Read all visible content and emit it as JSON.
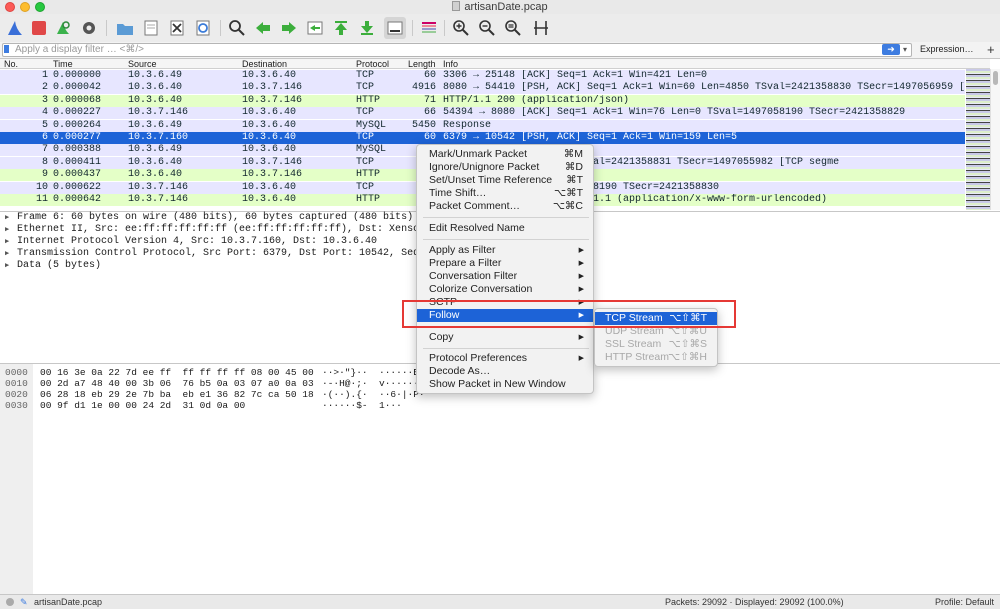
{
  "window": {
    "title": "artisanDate.pcap"
  },
  "filter": {
    "placeholder": "Apply a display filter … <⌘/>",
    "expression_label": "Expression…",
    "add_label": "+"
  },
  "columns": {
    "no": "No.",
    "time": "Time",
    "source": "Source",
    "destination": "Destination",
    "protocol": "Protocol",
    "length": "Length",
    "info": "Info"
  },
  "packets": [
    {
      "no": "1",
      "time": "0.000000",
      "src": "10.3.6.49",
      "dst": "10.3.6.40",
      "proto": "TCP",
      "len": "60",
      "info": "3306 → 25148 [ACK] Seq=1 Ack=1 Win=421 Len=0",
      "bg": "#e7e6ff",
      "fg": "#12272e"
    },
    {
      "no": "2",
      "time": "0.000042",
      "src": "10.3.6.40",
      "dst": "10.3.7.146",
      "proto": "TCP",
      "len": "4916",
      "info": "8080 → 54410 [PSH, ACK] Seq=1 Ack=1 Win=60 Len=4850 TSval=2421358830 TSecr=1497056959 [TCP segme",
      "bg": "#e7e6ff",
      "fg": "#12272e"
    },
    {
      "no": "3",
      "time": "0.000068",
      "src": "10.3.6.40",
      "dst": "10.3.7.146",
      "proto": "HTTP",
      "len": "71",
      "info": "HTTP/1.1 200   (application/json)",
      "bg": "#e4ffc7",
      "fg": "#12272e"
    },
    {
      "no": "4",
      "time": "0.000227",
      "src": "10.3.7.146",
      "dst": "10.3.6.40",
      "proto": "TCP",
      "len": "66",
      "info": "54394 → 8080 [ACK] Seq=1 Ack=1 Win=76 Len=0 TSval=1497058190 TSecr=2421358829",
      "bg": "#e7e6ff",
      "fg": "#12272e"
    },
    {
      "no": "5",
      "time": "0.000264",
      "src": "10.3.6.49",
      "dst": "10.3.6.40",
      "proto": "MySQL",
      "len": "5450",
      "info": "Response",
      "bg": "#e7e6ff",
      "fg": "#12272e"
    },
    {
      "no": "6",
      "time": "0.000277",
      "src": "10.3.7.160",
      "dst": "10.3.6.40",
      "proto": "TCP",
      "len": "60",
      "info": "6379 → 10542 [PSH, ACK] Seq=1 Ack=1 Win=159 Len=5",
      "bg": "#1d63d7",
      "fg": "#ffffff"
    },
    {
      "no": "7",
      "time": "0.000388",
      "src": "10.3.6.49",
      "dst": "10.3.6.40",
      "proto": "MySQL",
      "len": "",
      "info": "",
      "bg": "#e7e6ff",
      "fg": "#12272e"
    },
    {
      "no": "8",
      "time": "0.000411",
      "src": "10.3.6.40",
      "dst": "10.3.7.146",
      "proto": "TCP",
      "len": "",
      "info": "           Ack=1 Win=60 Len=4849 TSval=2421358831 TSecr=1497055982 [TCP segme",
      "bg": "#e7e6ff",
      "fg": "#12272e"
    },
    {
      "no": "9",
      "time": "0.000437",
      "src": "10.3.6.40",
      "dst": "10.3.7.146",
      "proto": "HTTP",
      "len": "",
      "info": "                                  /json)",
      "bg": "#e4ffc7",
      "fg": "#12272e"
    },
    {
      "no": "10",
      "time": "0.000622",
      "src": "10.3.7.146",
      "dst": "10.3.6.40",
      "proto": "TCP",
      "len": "",
      "info": "           Win=58 Len=0 TSval=1497058190 TSecr=2421358830",
      "bg": "#e7e6ff",
      "fg": "#12272e"
    },
    {
      "no": "11",
      "time": "0.000642",
      "src": "10.3.7.146",
      "dst": "10.3.6.40",
      "proto": "HTTP",
      "len": "",
      "info": "                                  t/stock/artisanDate HTTP/1.1  (application/x-www-form-urlencoded)",
      "bg": "#e4ffc7",
      "fg": "#12272e"
    }
  ],
  "details": [
    "Frame 6: 60 bytes on wire (480 bits), 60 bytes captured (480 bits)",
    "Ethernet II, Src: ee:ff:ff:ff:ff:ff (ee:ff:ff:ff:ff:ff), Dst: Xensourc_0a",
    "Internet Protocol Version 4, Src: 10.3.7.160, Dst: 10.3.6.40",
    "Transmission Control Protocol, Src Port: 6379, Dst Port: 10542, Seq: 1, Ac",
    "Data (5 bytes)"
  ],
  "bytes": [
    {
      "off": "0000",
      "hex": "00 16 3e 0a 22 7d ee ff  ff ff ff ff 08 00 45 00",
      "ascii": "··>·\"}··  ······E"
    },
    {
      "off": "0010",
      "hex": "00 2d a7 48 40 00 3b 06  76 b5 0a 03 07 a0 0a 03",
      "ascii": "·-·H@·;·  v·······"
    },
    {
      "off": "0020",
      "hex": "06 28 18 eb 29 2e 7b ba  eb e1 36 82 7c ca 50 18",
      "ascii": "·(··).{·  ··6·|·P·"
    },
    {
      "off": "0030",
      "hex": "00 9f d1 1e 00 00 24 2d  31 0d 0a 00",
      "ascii": "······$-  1···"
    }
  ],
  "context_menu": {
    "mark": {
      "label": "Mark/Unmark Packet",
      "shortcut": "⌘M"
    },
    "ignore": {
      "label": "Ignore/Unignore Packet",
      "shortcut": "⌘D"
    },
    "timeref": {
      "label": "Set/Unset Time Reference",
      "shortcut": "⌘T"
    },
    "timeshift": {
      "label": "Time Shift…",
      "shortcut": "⌥⌘T"
    },
    "comment": {
      "label": "Packet Comment…",
      "shortcut": "⌥⌘C"
    },
    "edit_resolved": {
      "label": "Edit Resolved Name"
    },
    "apply_filter": {
      "label": "Apply as Filter"
    },
    "prepare_filter": {
      "label": "Prepare a Filter"
    },
    "conv_filter": {
      "label": "Conversation Filter"
    },
    "colorize": {
      "label": "Colorize Conversation"
    },
    "sctp": {
      "label": "SCTP"
    },
    "follow": {
      "label": "Follow"
    },
    "copy": {
      "label": "Copy"
    },
    "proto_prefs": {
      "label": "Protocol Preferences"
    },
    "decode_as": {
      "label": "Decode As…"
    },
    "show_packet": {
      "label": "Show Packet in New Window"
    }
  },
  "follow_submenu": {
    "tcp": {
      "label": "TCP Stream",
      "shortcut": "⌥⇧⌘T"
    },
    "udp": {
      "label": "UDP Stream",
      "shortcut": "⌥⇧⌘U"
    },
    "ssl": {
      "label": "SSL Stream",
      "shortcut": "⌥⇧⌘S"
    },
    "http": {
      "label": "HTTP Stream",
      "shortcut": "⌥⇧⌘H"
    }
  },
  "status": {
    "file": "artisanDate.pcap",
    "packets": "Packets: 29092 · Displayed: 29092 (100.0%)",
    "profile": "Profile: Default"
  },
  "colors": {
    "selection": "#1d63d7",
    "tcp_row": "#e7e6ff",
    "http_row": "#e4ffc7",
    "highlight_box": "#e53935"
  }
}
